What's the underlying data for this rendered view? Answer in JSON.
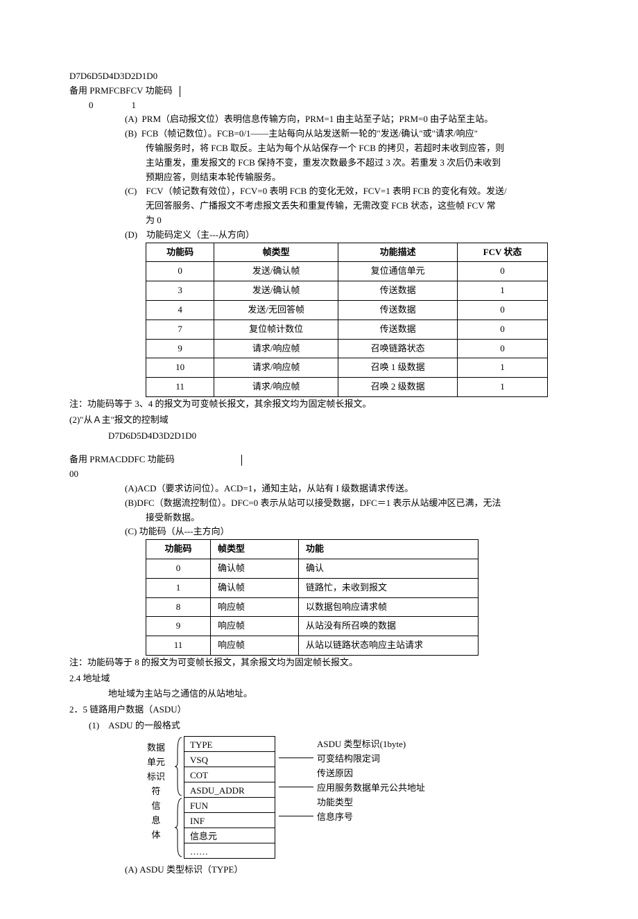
{
  "top1": "D7D6D5D4D3D2D1D0",
  "top2": "备用 PRMFCBFCV 功能码",
  "top3_0": "0",
  "top3_1": "1",
  "A_label": "(A)",
  "A_text": "PRM（启动报文位）表明信息传输方向，PRM=1 由主站至子站；PRM=0 由子站至主站。",
  "B_label": "(B)",
  "B_text1": "FCB（帧记数位）。FCB=0/1——主站每向从站发送新一轮的\"发送/确认\"或\"请求/响应\"",
  "B_text2": "传输服务时，将 FCB 取反。主站为每个从站保存一个 FCB 的拷贝，若超时未收到应答，则",
  "B_text3": "主站重发，重发报文的 FCB 保持不变，重发次数最多不超过 3 次。若重发 3 次后仍未收到",
  "B_text4": "预期应答，则结束本轮传输服务。",
  "C_label": "(C)",
  "C_text1": "FCV（帧记数有效位），FCV=0 表明 FCB 的变化无效，FCV=1 表明 FCB 的变化有效。发送/",
  "C_text2": "无回答服务、广播报文不考虑报文丢失和重复传输，无需改变 FCB 状态，这些帧 FCV 常",
  "C_text3": "为 0",
  "D_label": "(D)",
  "D_title": "功能码定义（主---从方向）",
  "t1": {
    "h1": "功能码",
    "h2": "帧类型",
    "h3": "功能描述",
    "h4": "FCV 状态",
    "rows": [
      {
        "c1": "0",
        "c2": "发送/确认帧",
        "c3": "复位通信单元",
        "c4": "0"
      },
      {
        "c1": "3",
        "c2": "发送/确认帧",
        "c3": "传送数据",
        "c4": "1"
      },
      {
        "c1": "4",
        "c2": "发送/无回答帧",
        "c3": "传送数据",
        "c4": "0"
      },
      {
        "c1": "7",
        "c2": "复位帧计数位",
        "c3": "传送数据",
        "c4": "0"
      },
      {
        "c1": "9",
        "c2": "请求/响应帧",
        "c3": "召唤链路状态",
        "c4": "0"
      },
      {
        "c1": "10",
        "c2": "请求/响应帧",
        "c3": "召唤 1 级数据",
        "c4": "1"
      },
      {
        "c1": "11",
        "c2": "请求/响应帧",
        "c3": "召唤 2 级数据",
        "c4": "1"
      }
    ]
  },
  "note1": "注：功能码等于 3、4 的报文为可变帧长报文，其余报文均为固定帧长报文。",
  "sec2_title": "(2)\"从Ａ主\"报文的控制域",
  "sec2_bits": "D7D6D5D4D3D2D1D0",
  "sec2_fields": "备用 PRMACDDFC 功能码",
  "sec2_zero": "00",
  "A2_label": "(A)",
  "A2_text": "ACD（要求访问位）。ACD=1，通知主站，从站有 I 级数据请求传送。",
  "B2_label": "(B)",
  "B2_text1": "DFC（数据流控制位）。DFC=0 表示从站可以接受数据，DFC＝1 表示从站缓冲区已满，无法",
  "B2_text2": "接受新数据。",
  "C2_label": "(C)",
  "C2_title": "功能码（从---主方向）",
  "t2": {
    "h1": "功能码",
    "h2": "帧类型",
    "h3": "功能",
    "rows": [
      {
        "c1": "0",
        "c2": "确认帧",
        "c3": "确认"
      },
      {
        "c1": "1",
        "c2": "确认帧",
        "c3": "链路忙，未收到报文"
      },
      {
        "c1": "8",
        "c2": "响应帧",
        "c3": "以数据包响应请求帧"
      },
      {
        "c1": "9",
        "c2": "响应帧",
        "c3": "从站没有所召唤的数据"
      },
      {
        "c1": "11",
        "c2": "响应帧",
        "c3": "从站以链路状态响应主站请求"
      }
    ]
  },
  "note2": "注：功能码等于 8 的报文为可变帧长报文，其余报文均为固定帧长报文。",
  "sec24": "2.4 地址域",
  "sec24_text": "地址域为主站与之通信的从站地址。",
  "sec25": "2．5 链路用户数据（ASDU）",
  "sec25_1": "(1)",
  "sec25_1_title": "ASDU 的一般格式",
  "asdu": {
    "lbl1a": "数据",
    "lbl1b": "单元",
    "lbl1c": "标识",
    "lbl1d": "符",
    "lbl2a": "信",
    "lbl2b": "息",
    "lbl2c": "体",
    "f1": "TYPE",
    "f2": "VSQ",
    "f3": "COT",
    "f4": "ASDU_ADDR",
    "f5": "FUN",
    "f6": "INF",
    "f7": "信息元",
    "f8": "……",
    "d1": "ASDU 类型标识(1byte)",
    "d2": "可变结构限定词",
    "d3": "传送原因",
    "d4": "应用服务数据单元公共地址",
    "d5": "功能类型",
    "d6": "信息序号"
  },
  "sec25_A": "(A)",
  "sec25_A_text": "ASDU 类型标识（TYPE）"
}
